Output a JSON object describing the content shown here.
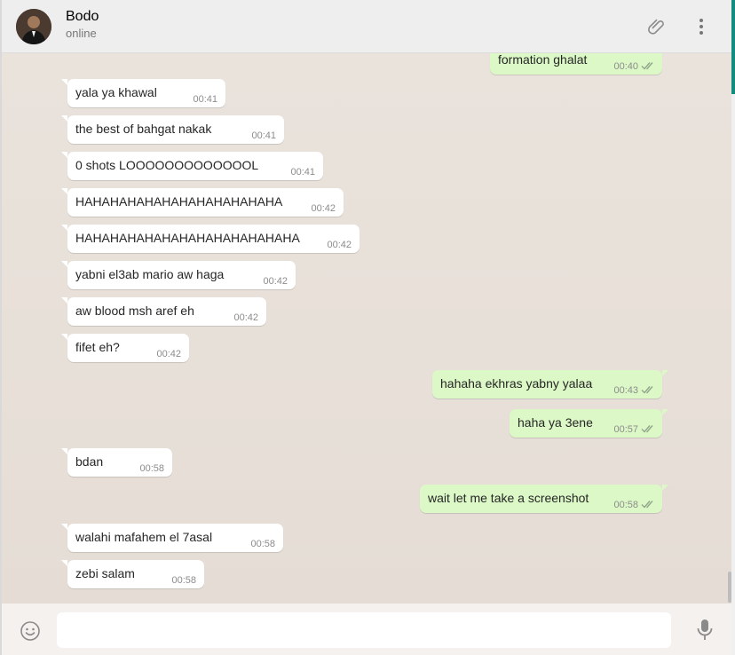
{
  "header": {
    "contact_name": "Bodo",
    "status": "online",
    "attach_icon": "paperclip-icon",
    "menu_icon": "more-vertical-icon"
  },
  "messages": [
    {
      "dir": "out",
      "text": "formation ghalat",
      "time": "00:40",
      "ticks": "double-check-icon"
    },
    {
      "dir": "in",
      "text": "yala ya khawal",
      "time": "00:41"
    },
    {
      "dir": "in",
      "text": "the best of bahgat nakak",
      "time": "00:41"
    },
    {
      "dir": "in",
      "text": "0 shots LOOOOOOOOOOOOOL",
      "time": "00:41"
    },
    {
      "dir": "in",
      "text": "HAHAHAHAHAHAHAHAHAHAHAHA",
      "time": "00:42"
    },
    {
      "dir": "in",
      "text": "HAHAHAHAHAHAHAHAHAHAHAHAHA",
      "time": "00:42"
    },
    {
      "dir": "in",
      "text": "yabni el3ab mario aw haga",
      "time": "00:42"
    },
    {
      "dir": "in",
      "text": "aw blood msh aref eh",
      "time": "00:42"
    },
    {
      "dir": "in",
      "text": "fifet eh?",
      "time": "00:42"
    },
    {
      "dir": "out",
      "text": "hahaha ekhras yabny yalaa",
      "time": "00:43",
      "ticks": "double-check-icon"
    },
    {
      "dir": "out",
      "text": "haha ya 3ene",
      "time": "00:57",
      "ticks": "double-check-icon"
    },
    {
      "dir": "in",
      "text": "bdan",
      "time": "00:58"
    },
    {
      "dir": "out",
      "text": "wait let me take a screenshot",
      "time": "00:58",
      "ticks": "double-check-icon"
    },
    {
      "dir": "in",
      "text": "walahi mafahem el 7asal",
      "time": "00:58"
    },
    {
      "dir": "in",
      "text": "zebi salam",
      "time": "00:58"
    }
  ],
  "footer": {
    "emoji_icon": "smiley-icon",
    "compose_value": "",
    "mic_icon": "microphone-icon"
  },
  "colors": {
    "chat_background": "#e5ddd5",
    "incoming_bubble": "#ffffff",
    "outgoing_bubble": "#dcf8c6",
    "accent": "#128c7e"
  }
}
